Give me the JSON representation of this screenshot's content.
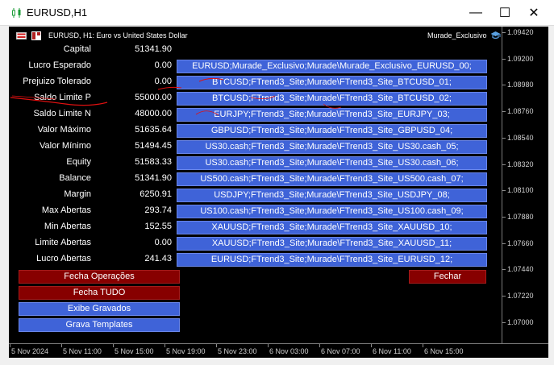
{
  "window": {
    "title": "EURUSD,H1",
    "app_icon": "candlestick-chart-icon",
    "buttons": {
      "minimize": "—",
      "maximize": "☐",
      "close": "✕"
    }
  },
  "chart_header": {
    "symbol_title": "EURUSD, H1:  Euro vs United States Dollar",
    "expert_name": "Murade_Exclusivo",
    "expert_icon": "graduation-cap-icon"
  },
  "panel": {
    "rows": [
      {
        "label": "Capital",
        "value": "51341.90"
      },
      {
        "label": "Lucro Esperado",
        "value": "0.00"
      },
      {
        "label": "Prejuizo Tolerado",
        "value": "0.00"
      },
      {
        "label": "Saldo Limite P",
        "value": "55000.00"
      },
      {
        "label": "Saldo Limite N",
        "value": "48000.00"
      },
      {
        "label": "Valor Máximo",
        "value": "51635.64"
      },
      {
        "label": "Valor Mínimo",
        "value": "51494.45"
      },
      {
        "label": "Equity",
        "value": "51583.33"
      },
      {
        "label": "Balance",
        "value": "51341.90"
      },
      {
        "label": "Margin",
        "value": "6250.91"
      },
      {
        "label": "Max Abertas",
        "value": "293.74"
      },
      {
        "label": "Min Abertas",
        "value": "152.55"
      },
      {
        "label": "Limite Abertas",
        "value": "0.00"
      },
      {
        "label": "Lucro Abertas",
        "value": "241.43"
      }
    ],
    "symbols": [
      "EURUSD;Murade_Exclusivo;Murade\\Murade_Exclusivo_EURUSD_00;",
      "BTCUSD;FTrend3_Site;Murade\\FTrend3_Site_BTCUSD_01;",
      "BTCUSD;FTrend3_Site;Murade\\FTrend3_Site_BTCUSD_02;",
      "EURJPY;FTrend3_Site;Murade\\FTrend3_Site_EURJPY_03;",
      "GBPUSD;FTrend3_Site;Murade\\FTrend3_Site_GBPUSD_04;",
      "US30.cash;FTrend3_Site;Murade\\FTrend3_Site_US30.cash_05;",
      "US30.cash;FTrend3_Site;Murade\\FTrend3_Site_US30.cash_06;",
      "US500.cash;FTrend3_Site;Murade\\FTrend3_Site_US500.cash_07;",
      "USDJPY;FTrend3_Site;Murade\\FTrend3_Site_USDJPY_08;",
      "US100.cash;FTrend3_Site;Murade\\FTrend3_Site_US100.cash_09;",
      "XAUUSD;FTrend3_Site;Murade\\FTrend3_Site_XAUUSD_10;",
      "XAUUSD;FTrend3_Site;Murade\\FTrend3_Site_XAUUSD_11;",
      "EURUSD;FTrend3_Site;Murade\\FTrend3_Site_EURUSD_12;"
    ],
    "actions": {
      "fecha_operacoes": "Fecha Operações",
      "fecha_tudo": "Fecha TUDO",
      "exibe_gravados": "Exibe Gravados",
      "grava_templates": "Grava Templates",
      "fechar": "Fechar"
    }
  },
  "price_axis": [
    "1.09420",
    "1.09200",
    "1.08980",
    "1.08760",
    "1.08540",
    "1.08320",
    "1.08100",
    "1.07880",
    "1.07660",
    "1.07440",
    "1.07220",
    "1.07000"
  ],
  "time_axis": [
    "5 Nov 2024",
    "5 Nov 11:00",
    "5 Nov 15:00",
    "5 Nov 19:00",
    "5 Nov 23:00",
    "6 Nov 03:00",
    "6 Nov 07:00",
    "6 Nov 11:00",
    "6 Nov 15:00"
  ],
  "colors": {
    "chart_bg": "#000000",
    "button_blue": "#3f63d8",
    "button_red": "#870000",
    "annotation_red": "#e01010"
  }
}
